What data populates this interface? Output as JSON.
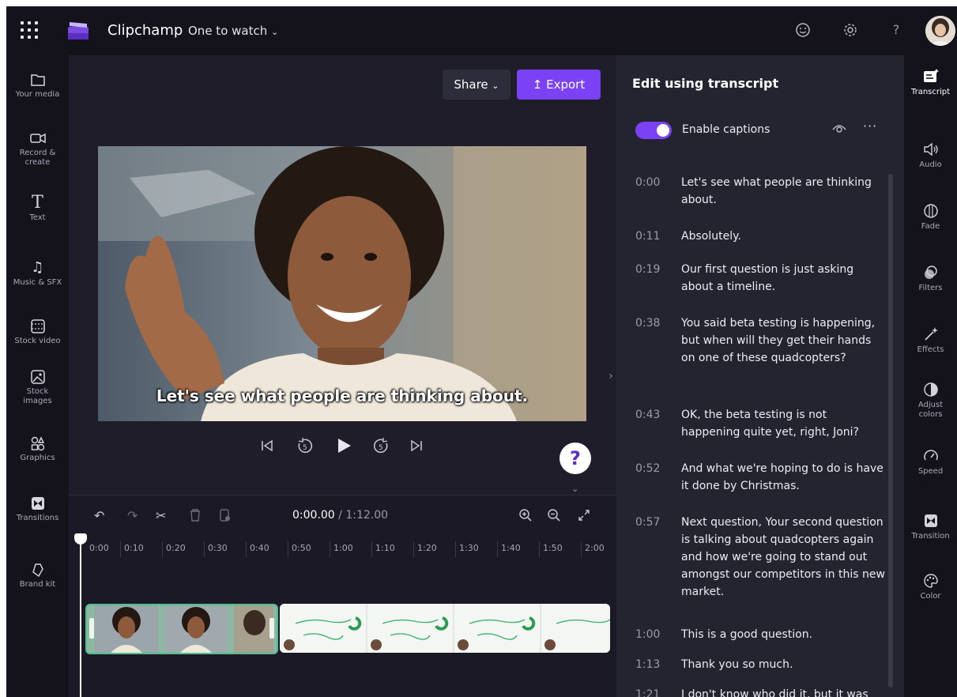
{
  "app": {
    "title": "Clipchamp",
    "project_name": "One to watch"
  },
  "left_nav": [
    {
      "label": "Your media",
      "icon": "folder-icon"
    },
    {
      "label": "Record & create",
      "icon": "camera-icon"
    },
    {
      "label": "Text",
      "icon": "text-icon"
    },
    {
      "label": "Music & SFX",
      "icon": "music-icon"
    },
    {
      "label": "Stock video",
      "icon": "film-icon"
    },
    {
      "label": "Stock images",
      "icon": "image-icon"
    },
    {
      "label": "Graphics",
      "icon": "shapes-icon"
    },
    {
      "label": "Transitions",
      "icon": "transition-icon"
    },
    {
      "label": "Brand kit",
      "icon": "brand-kit-icon"
    }
  ],
  "preview": {
    "share_label": "Share",
    "export_label": "Export",
    "caption": "Let's see what people are thinking about.",
    "help_label": "?"
  },
  "timeline": {
    "current_time": "0:00.00",
    "total_time": "/ 1:12.00",
    "ruler": [
      "0:00",
      "0:10",
      "0:20",
      "0:30",
      "0:40",
      "0:50",
      "1:00",
      "1:10",
      "1:20",
      "1:30",
      "1:40",
      "1:50",
      "2:00"
    ]
  },
  "transcript_panel": {
    "title": "Edit using transcript",
    "enable_captions_label": "Enable captions",
    "captions_enabled": true,
    "more_label": "···",
    "entries": [
      {
        "time": "0:00",
        "text": "Let's see what people are thinking about."
      },
      {
        "time": "0:11",
        "text": "Absolutely."
      },
      {
        "time": "0:19",
        "text": "Our first question is just asking about a timeline."
      },
      {
        "time": "0:38",
        "text": "You said beta testing is happening, but when will they get their hands on one of these quadcopters?"
      },
      {
        "time": "0:43",
        "text": "OK, the beta testing is not happening quite yet, right, Joni?"
      },
      {
        "time": "0:52",
        "text": "And what we're hoping to do is have it done by Christmas."
      },
      {
        "time": "0:57",
        "text": "Next question, Your second question is talking about quadcopters again and how we're going to stand out amongst our competitors in this new market."
      },
      {
        "time": "1:00",
        "text": "This is a good question."
      },
      {
        "time": "1:13",
        "text": "Thank you so much."
      },
      {
        "time": "1:21",
        "text": "I don't know who did it, but it was"
      }
    ]
  },
  "right_tools": [
    {
      "label": "Transcript",
      "icon": "transcript-icon"
    },
    {
      "label": "Audio",
      "icon": "speaker-icon"
    },
    {
      "label": "Fade",
      "icon": "fade-icon"
    },
    {
      "label": "Filters",
      "icon": "filters-icon"
    },
    {
      "label": "Effects",
      "icon": "magic-wand-icon"
    },
    {
      "label": "Adjust colors",
      "icon": "contrast-icon"
    },
    {
      "label": "Speed",
      "icon": "speedometer-icon"
    },
    {
      "label": "Transition",
      "icon": "transition-icon"
    },
    {
      "label": "Color",
      "icon": "palette-icon"
    }
  ],
  "colors": {
    "accent": "#7a42f4",
    "background": "#1e1d29",
    "clip_border": "#4fc08d"
  }
}
